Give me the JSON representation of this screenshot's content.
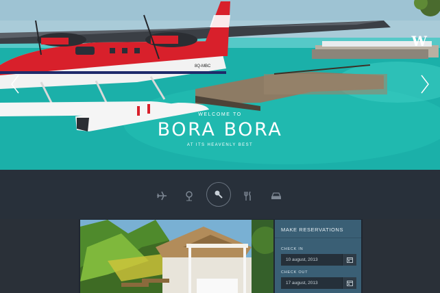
{
  "hero": {
    "welcome": "WELCOME TO",
    "title": "BORA BORA",
    "subtitle": "AT ITS HEAVENLY BEST",
    "logo": "W",
    "plane_registration": "8Q-MBC"
  },
  "nav": {
    "icons": [
      "plane-icon",
      "location-pin-icon",
      "key-icon",
      "fork-knife-icon",
      "car-icon"
    ],
    "active": "key-icon"
  },
  "reservation": {
    "title": "MAKE RESERVATIONS",
    "check_in_label": "CHECK IN",
    "check_in_value": "10 august, 2013",
    "check_out_label": "CHECK OUT",
    "check_out_value": "17 august, 2013"
  },
  "colors": {
    "page_bg": "#2a3038",
    "panel": "#3a5f75",
    "water": "#1fb3ad",
    "plane_red": "#d8202b"
  }
}
